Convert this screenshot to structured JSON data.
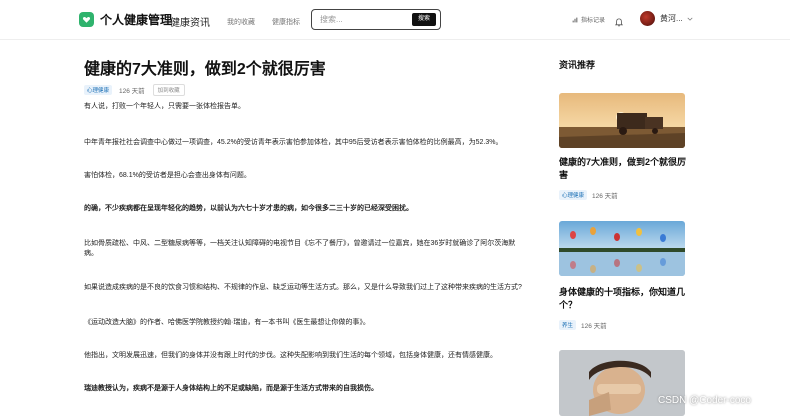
{
  "header": {
    "brand": "个人健康管理",
    "nav": [
      "健康资讯",
      "我的收藏",
      "健康指标"
    ],
    "search_placeholder": "搜索...",
    "search_button": "搜索",
    "record_label": "指标记录",
    "user_name": "黄河..."
  },
  "article": {
    "title": "健康的7大准则，做到2个就很厉害",
    "tag": "心理健康",
    "days": "126 天前",
    "favorite": "加到收藏",
    "paragraphs": [
      {
        "text": "有人说，打败一个年轻人，只需要一张体检报告单。",
        "bold": false
      },
      {
        "text": "中年青年报社社会调查中心做过一项调查，45.2%的受访青年表示害怕参加体检，其中95后受访者表示害怕体检的比例最高，为52.3%。",
        "bold": false
      },
      {
        "text": "害怕体检，68.1%的受访者是担心会查出身体有问题。",
        "bold": false
      },
      {
        "text": "的确，不少疾病都在呈现年轻化的趋势，以前认为六七十岁才患的病，如今很多二三十岁的已经深受困扰。",
        "bold": true
      },
      {
        "text": "比如骨质疏松、中风、二型糖尿病等等，一档关注认知障碍的电视节目《忘不了餐厅》，曾邀请过一位嘉宾，她在36岁时就确诊了阿尔茨海默病。",
        "bold": false
      },
      {
        "text": "如果说造成疾病的是不良的饮食习惯和结构、不规律的作息、缺乏运动等生活方式。那么，又是什么导致我们过上了这种带来疾病的生活方式?",
        "bold": false
      },
      {
        "text": "《运动改造大脑》的作者、哈佛医学院教授约翰·瑞迪，有一本书叫《医生最想让你做的事》。",
        "bold": false
      },
      {
        "text": "他指出，文明发展迅速，但我们的身体并没有跟上时代的步伐。这种失配影响到我们生活的每个领域，包括身体健康，还有情感健康。",
        "bold": false
      },
      {
        "text": "瑞迪教授认为，疾病不是源于人身体结构上的不足或缺陷，而是源于生活方式带来的自我损伤。",
        "bold": true
      }
    ]
  },
  "sidebar": {
    "title": "资讯推荐",
    "cards": [
      {
        "title": "健康的7大准则，做到2个就很厉害",
        "tag": "心理健康",
        "days": "126 天前",
        "image": "farm-sunset-photo"
      },
      {
        "title": "身体健康的十项指标，你知道几个？",
        "tag": "养生",
        "days": "126 天前",
        "image": "hot-air-balloons-photo"
      },
      {
        "title": "",
        "tag": "",
        "days": "",
        "image": "tired-person-photo"
      }
    ]
  },
  "watermark": "CSDN @Coder-coco",
  "colors": {
    "brand": "#2fb36d",
    "tag_text": "#1b6fb5",
    "tag_bg": "#e9f2fb"
  }
}
